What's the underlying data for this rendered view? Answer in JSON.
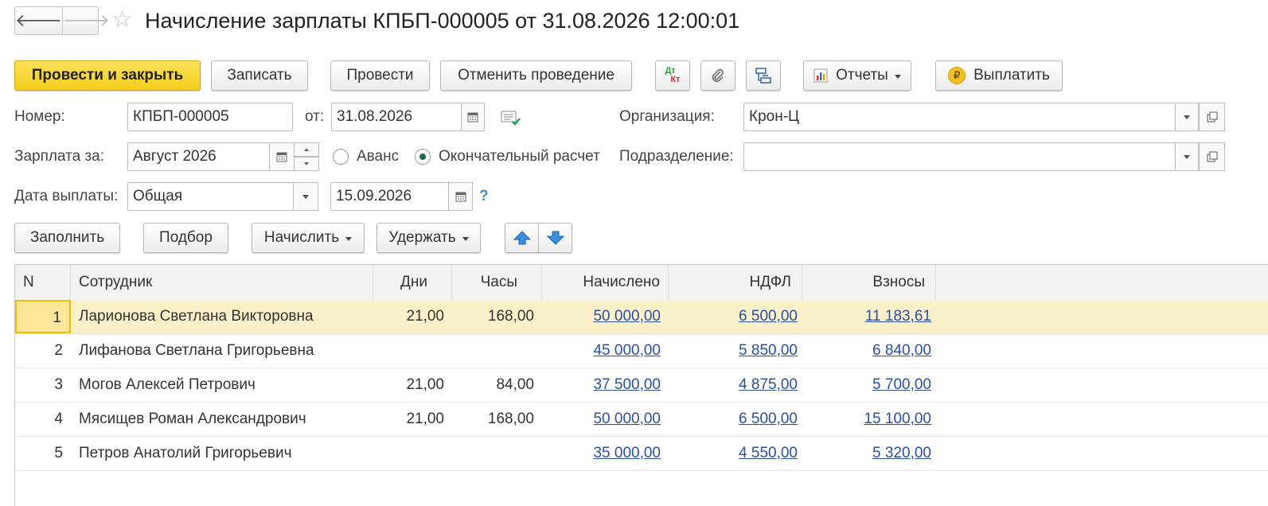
{
  "title": "Начисление зарплаты КПБП-000005 от 31.08.2026 12:00:01",
  "nav": {
    "back": "🡐",
    "forward": "🡒"
  },
  "toolbar": {
    "post_close": "Провести и закрыть",
    "save": "Записать",
    "post": "Провести",
    "cancel_post": "Отменить проведение",
    "dtkt_top": "Дт",
    "dtkt_bottom": "Кт",
    "reports": "Отчеты",
    "pay": "Выплатить"
  },
  "form": {
    "number_label": "Номер:",
    "number_value": "КПБП-000005",
    "date_label": "от:",
    "date_value": "31.08.2026",
    "org_label": "Организация:",
    "org_value": "Крон-Ц",
    "salary_for_label": "Зарплата за:",
    "salary_for_value": "Август 2026",
    "radio_advance": "Аванс",
    "radio_final": "Окончательный расчет",
    "radio_selected": "final",
    "division_label": "Подразделение:",
    "division_value": "",
    "pay_date_label": "Дата выплаты:",
    "pay_date_type": "Общая",
    "pay_date_value": "15.09.2026",
    "help": "?"
  },
  "table_toolbar": {
    "fill": "Заполнить",
    "pick": "Подбор",
    "accrue": "Начислить",
    "withhold": "Удержать"
  },
  "table": {
    "columns": [
      "N",
      "Сотрудник",
      "Дни",
      "Часы",
      "Начислено",
      "НДФЛ",
      "Взносы"
    ],
    "selected_row": 0,
    "rows": [
      {
        "n": "1",
        "employee": "Ларионова Светлана Викторовна",
        "days": "21,00",
        "hours": "168,00",
        "accrued": "50 000,00",
        "ndfl": "6 500,00",
        "contrib": "11 183,61"
      },
      {
        "n": "2",
        "employee": "Лифанова Светлана Григорьевна",
        "days": "",
        "hours": "",
        "accrued": "45 000,00",
        "ndfl": "5 850,00",
        "contrib": "6 840,00"
      },
      {
        "n": "3",
        "employee": "Могов Алексей Петрович",
        "days": "21,00",
        "hours": "84,00",
        "accrued": "37 500,00",
        "ndfl": "4 875,00",
        "contrib": "5 700,00"
      },
      {
        "n": "4",
        "employee": "Мясищев Роман Александрович",
        "days": "21,00",
        "hours": "168,00",
        "accrued": "50 000,00",
        "ndfl": "6 500,00",
        "contrib": "15 100,00"
      },
      {
        "n": "5",
        "employee": "Петров Анатолий Григорьевич",
        "days": "",
        "hours": "",
        "accrued": "35 000,00",
        "ndfl": "4 550,00",
        "contrib": "5 320,00"
      }
    ]
  },
  "colors": {
    "primary_button": "#f4cd1a",
    "selected_row": "#fbf1c9",
    "link": "#2b4fa6"
  }
}
